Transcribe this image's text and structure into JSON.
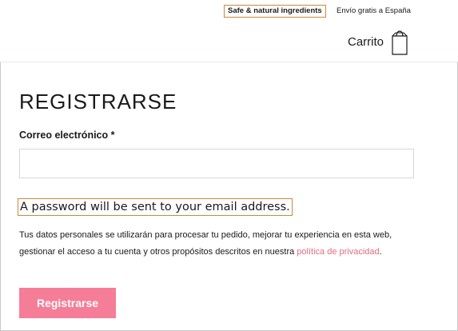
{
  "header": {
    "promo_badge": "Safe & natural ingredients",
    "shipping_text": "Envío gratis a España",
    "cart_label": "Carrito",
    "cart_icon": "shopping-bag-icon"
  },
  "form": {
    "title": "REGISTRARSE",
    "email_label": "Correo electrónico *",
    "email_value": "",
    "email_placeholder": "",
    "password_note": "A password will be sent to your email address.",
    "privacy_text_before": "Tus datos personales se utilizarán para procesar tu pedido, mejorar tu experiencia en esta web, gestionar el acceso a tu cuenta y otros propósitos descritos en nuestra ",
    "privacy_link": "política de privacidad",
    "privacy_text_after": ".",
    "submit_label": "Registrarse"
  },
  "colors": {
    "accent_pink": "#f67d97",
    "link_pink": "#e26b83",
    "highlight_border": "#c98a3a"
  }
}
